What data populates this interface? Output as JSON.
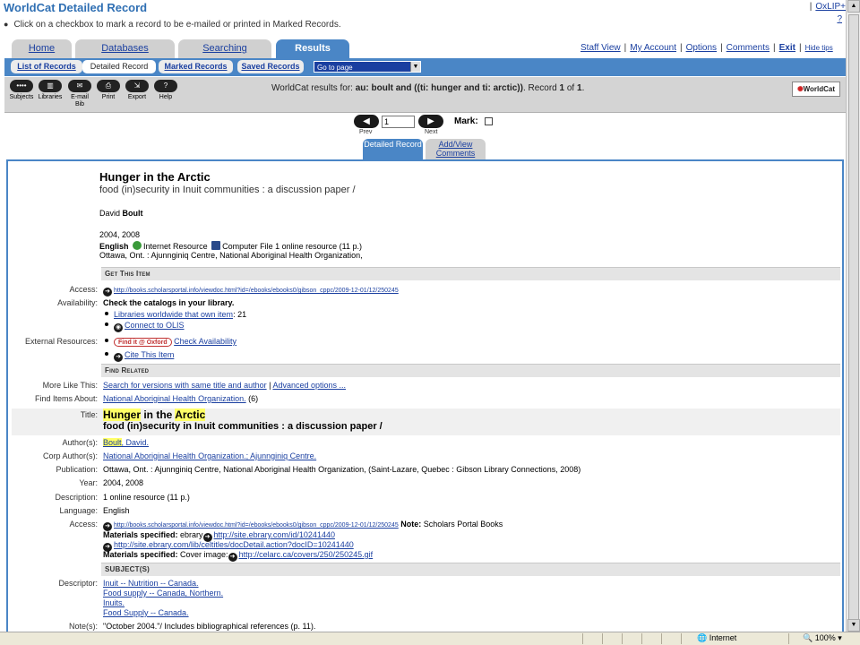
{
  "header": {
    "title": "WorldCat Detailed Record",
    "instruction": "Click on a checkbox to mark a record to be e-mailed or printed in Marked Records.",
    "top_link": "OxLIP+",
    "help_link": "?"
  },
  "main_tabs": [
    "Home",
    "Databases",
    "Searching",
    "Results"
  ],
  "util_links": {
    "staff_view": "Staff View",
    "my_account": "My Account",
    "options": "Options",
    "comments": "Comments",
    "exit": "Exit",
    "hide_tips": "Hide tips"
  },
  "sub_tabs": [
    "List of Records",
    "Detailed Record",
    "Marked Records",
    "Saved Records"
  ],
  "goto_page": "Go to page",
  "toolbar": {
    "tools": [
      "Subjects",
      "Libraries",
      "E-mail Bib",
      "Print",
      "Export",
      "Help"
    ],
    "summary_prefix": "WorldCat results for: ",
    "summary_query": "au: boult and ((ti: hunger and ti: arctic))",
    "summary_record": ". Record ",
    "record_num": "1",
    "of": " of ",
    "total": "1",
    "logo": "WorldCat"
  },
  "record_nav": {
    "prev": "Prev",
    "next": "Next",
    "current": "1",
    "mark": "Mark:"
  },
  "record_tabs": {
    "detailed": "Detailed Record",
    "comments": "Add/View Comments"
  },
  "record": {
    "title": "Hunger in the Arctic",
    "subtitle": "food (in)security in Inuit communities : a discussion paper /",
    "author_first": "David ",
    "author_last": "Boult",
    "date": "2004, 2008",
    "language": "English",
    "format1": "Internet Resource",
    "format2": "Computer File",
    "format_rest": "1 online resource (11 p.)",
    "pub": "Ottawa, Ont. : Ajunnginiq Centre, National Aboriginal Health Organization,"
  },
  "sections": {
    "get_this": "Get This Item",
    "find_related": "Find Related",
    "subjects": "SUBJECT(S)"
  },
  "fields": {
    "access_label": "Access:",
    "access_url": "http://books.scholarsportal.info/viewdoc.html?id=/ebooks/ebooks0/gibson_cppc/2009-12-01/12/250245",
    "availability_label": "Availability:",
    "availability_text": "Check the catalogs in your library.",
    "libraries_link": "Libraries worldwide that own item",
    "libraries_count": ": 21",
    "olis_link": "Connect to OLIS",
    "external_label": "External Resources:",
    "findit": "Find it @ Oxford",
    "check_availability": "Check Availability",
    "cite_link": "Cite This Item",
    "more_like_label": "More Like This:",
    "more_like_link1": "Search for versions with same title and author",
    "more_like_sep": " | ",
    "more_like_link2": "Advanced options ...",
    "find_items_label": "Find Items About:",
    "find_items_link": "National Aboriginal Health Organization.",
    "find_items_count": " (6)",
    "title_label": "Title:",
    "title_hl1": "Hunger",
    "title_mid": " in the ",
    "title_hl2": "Arctic",
    "title_sub": "food (in)security in Inuit communities : a discussion paper /",
    "author_label": "Author(s):",
    "author_hl": "Boult",
    "author_rest": ", David.",
    "corp_label": "Corp Author(s):",
    "corp_link": "National Aboriginal Health Organization.; Ajunnginiq Centre.",
    "publication_label": "Publication:",
    "publication_text": "Ottawa, Ont. : Ajunnginiq Centre, National Aboriginal Health Organization, (Saint-Lazare, Quebec : Gibson Library Connections, 2008)",
    "year_label": "Year:",
    "year_text": "2004, 2008",
    "description_label": "Description:",
    "description_text": "1 online resource (11 p.)",
    "language_label": "Language:",
    "language_text": "English",
    "access2_label": "Access:",
    "access2_url": "http://books.scholarsportal.info/viewdoc.html?id=/ebooks/ebooks0/gibson_cppc/2009-12-01/12/250245",
    "access2_note_label": "Note:",
    "access2_note": " Scholars Portal Books",
    "materials_label": "Materials specified:",
    "materials1_pre": " ebrary",
    "materials1_url": "http://site.ebrary.com/id/10241440",
    "materials2_url": "http://site.ebrary.com/lib/celtitles/docDetail.action?docID=10241440",
    "materials3_pre": " Cover image:",
    "materials3_url": "http://celarc.ca/covers/250/250245.gif",
    "descriptor_label": "Descriptor:",
    "descriptors": [
      "Inuit -- Nutrition -- Canada.",
      "Food supply -- Canada, Northern.",
      "Inuits.",
      "Food Supply -- Canada."
    ],
    "notes_label": "Note(s):",
    "notes_text": "\"October 2004.\"/ Includes bibliographical references (p. 11)."
  },
  "statusbar": {
    "zone": "Internet",
    "zoom": "100%"
  }
}
